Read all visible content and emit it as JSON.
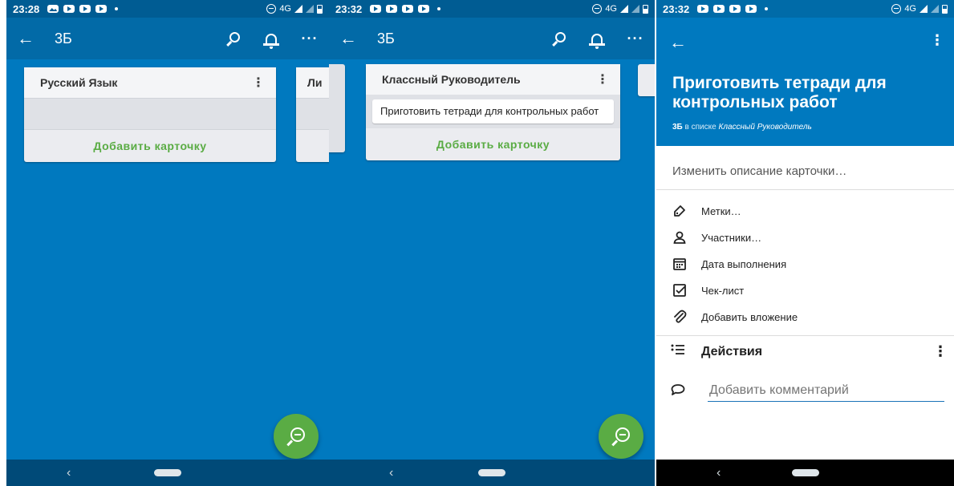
{
  "screen1": {
    "status_time": "23:28",
    "status_network": "4G",
    "board_title": "3Б",
    "lists": [
      {
        "title": "Русский Язык",
        "add_card": "Добавить карточку"
      },
      {
        "title": "Ли"
      }
    ]
  },
  "screen2": {
    "status_time": "23:32",
    "status_network": "4G",
    "board_title": "3Б",
    "list": {
      "title": "Классный Руководитель",
      "card": "Приготовить тетради для контрольных работ",
      "add_card": "Добавить карточку"
    }
  },
  "screen3": {
    "status_time": "23:32",
    "status_network": "4G",
    "card_title": "Приготовить тетради для контрольных работ",
    "sub_board": "3Б",
    "sub_middle": " в списке ",
    "sub_list": "Классный Руководитель",
    "description_placeholder": "Изменить описание карточки…",
    "options": [
      {
        "label": "Метки…",
        "icon": "tag-icon"
      },
      {
        "label": "Участники…",
        "icon": "person-icon"
      },
      {
        "label": "Дата выполнения",
        "icon": "calendar-icon"
      },
      {
        "label": "Чек-лист",
        "icon": "checkbox-icon"
      },
      {
        "label": "Добавить вложение",
        "icon": "paperclip-icon"
      }
    ],
    "activity_title": "Действия",
    "comment_placeholder": "Добавить комментарий"
  },
  "colors": {
    "board_blue": "#0079BF",
    "appbar": "#026AA7",
    "fab_green": "#5AAC44"
  }
}
